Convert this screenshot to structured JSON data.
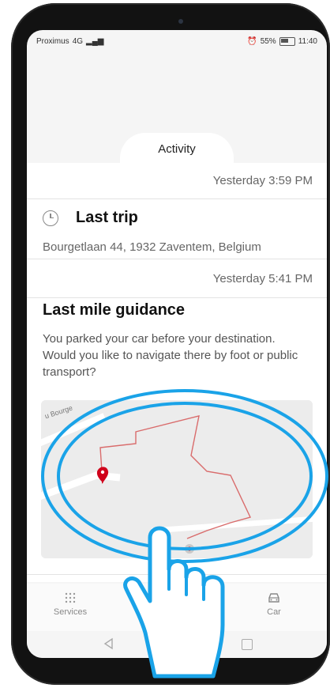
{
  "status_bar": {
    "carrier": "Proximus",
    "signal": "4G",
    "battery": "55%",
    "time": "11:40"
  },
  "header": {
    "tab_label": "Activity"
  },
  "last_trip": {
    "timestamp": "Yesterday 3:59 PM",
    "title": "Last trip",
    "address": "Bourgetlaan 44, 1932 Zaventem, Belgium"
  },
  "last_mile": {
    "timestamp": "Yesterday 5:41 PM",
    "title": "Last mile guidance",
    "body": "You parked your car before your destination. Would you like to navigate there by foot or public transport?",
    "map_street": "u Bourge"
  },
  "bottom_nav": {
    "services_label": "Services",
    "car_label": "Car"
  },
  "colors": {
    "accent_red": "#d0021b",
    "route_line": "#d96b6b",
    "highlight_blue": "#1aa3e8"
  },
  "icons": [
    "clock-icon",
    "map-pin-icon",
    "services-grid-icon",
    "car-icon",
    "back-icon",
    "recent-apps-icon",
    "tap-hand-icon"
  ]
}
